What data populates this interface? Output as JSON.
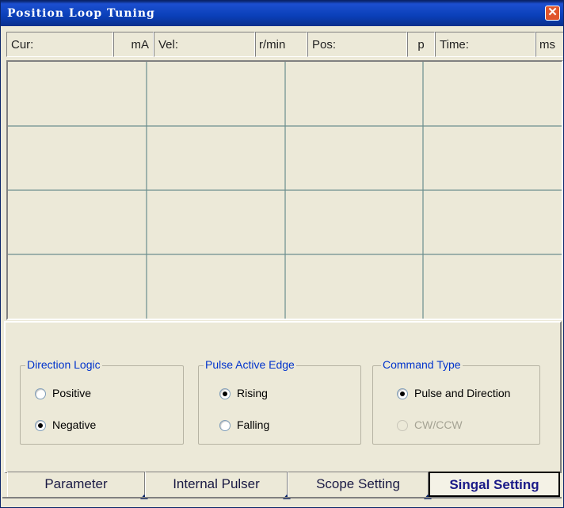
{
  "window": {
    "title": "Position Loop Tuning"
  },
  "status": [
    {
      "label": "Cur:",
      "unit": "mA"
    },
    {
      "label": "Vel:",
      "unit": "r/min"
    },
    {
      "label": "Pos:",
      "unit": "p"
    },
    {
      "label": "Time:",
      "unit": "ms"
    }
  ],
  "scope": {
    "columns": 4,
    "rows": 4,
    "grid_color": "#6b8e8e"
  },
  "groups": {
    "direction": {
      "title": "Direction Logic",
      "options": [
        {
          "label": "Positive",
          "checked": false
        },
        {
          "label": "Negative",
          "checked": true
        }
      ]
    },
    "edge": {
      "title": "Pulse Active Edge",
      "options": [
        {
          "label": "Rising",
          "checked": true
        },
        {
          "label": "Falling",
          "checked": false
        }
      ]
    },
    "command": {
      "title": "Command Type",
      "options": [
        {
          "label": "Pulse and Direction",
          "checked": true
        },
        {
          "label": "CW/CCW",
          "checked": false,
          "disabled": true
        }
      ]
    }
  },
  "tabs": [
    {
      "label": "Parameter"
    },
    {
      "label": "Internal Pulser"
    },
    {
      "label": "Scope Setting"
    },
    {
      "label": "Singal Setting",
      "active": true
    }
  ]
}
